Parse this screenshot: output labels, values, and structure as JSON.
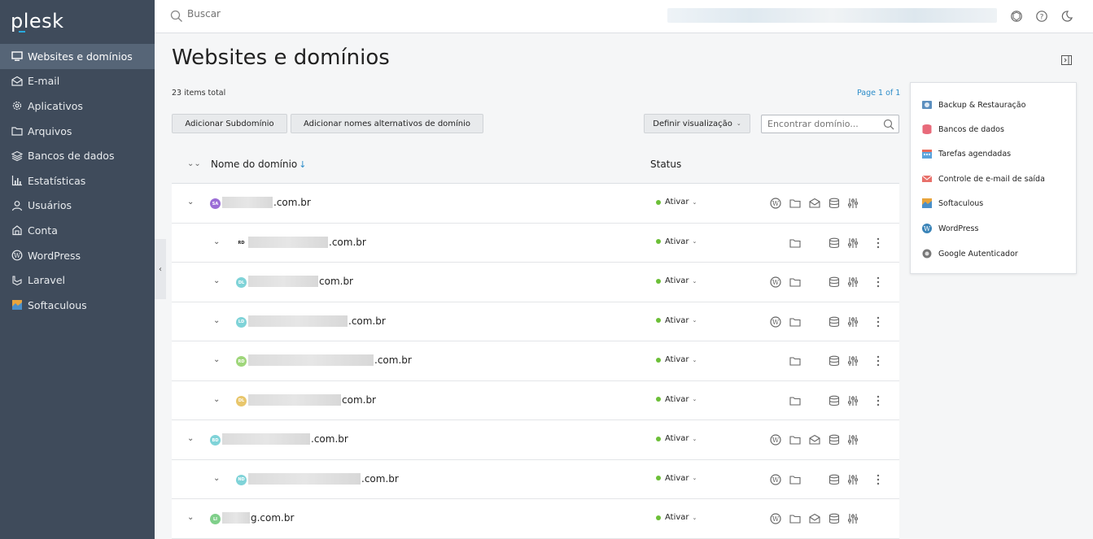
{
  "app": {
    "logo": "plesk"
  },
  "sidebar": {
    "items": [
      {
        "label": "Websites e domínios",
        "icon": "monitor-icon",
        "active": true
      },
      {
        "label": "E-mail",
        "icon": "envelope-icon"
      },
      {
        "label": "Aplicativos",
        "icon": "gear-icon"
      },
      {
        "label": "Arquivos",
        "icon": "folder-icon"
      },
      {
        "label": "Bancos de dados",
        "icon": "layers-icon"
      },
      {
        "label": "Estatísticas",
        "icon": "bar-chart-icon"
      },
      {
        "label": "Usuários",
        "icon": "user-icon"
      },
      {
        "label": "Conta",
        "icon": "account-icon"
      },
      {
        "label": "WordPress",
        "icon": "wordpress-icon"
      },
      {
        "label": "Laravel",
        "icon": "laravel-icon"
      },
      {
        "label": "Softaculous",
        "icon": "softaculous-icon"
      }
    ]
  },
  "topbar": {
    "search_placeholder": "Buscar",
    "icons": [
      "extensions-icon",
      "help-icon",
      "dark-mode-icon"
    ]
  },
  "main": {
    "title": "Websites e domínios",
    "items_total": "23 items total",
    "pagination": "Page 1 of 1",
    "buttons": {
      "add_subdomain": "Adicionar Subdomínio",
      "add_alias": "Adicionar nomes alternativos de domínio",
      "view": "Definir visualização"
    },
    "find_placeholder": "Encontrar domínio..."
  },
  "table": {
    "col_name": "Nome do domínio",
    "col_status": "Status",
    "rows": [
      {
        "suffix": ".com.br",
        "status": "Ativar",
        "badge": "SA",
        "badge_color": "#9b6dd6",
        "level": 0
      },
      {
        "suffix": ".com.br",
        "status": "Ativar",
        "badge": "RD",
        "badge_color": "#ffffff",
        "level": 1
      },
      {
        "suffix": "com.br",
        "status": "Ativar",
        "badge": "DL",
        "badge_color": "#7fd3d8",
        "level": 1
      },
      {
        "suffix": ".com.br",
        "status": "Ativar",
        "badge": "LD",
        "badge_color": "#7fd3d8",
        "level": 1
      },
      {
        "suffix": ".com.br",
        "status": "Ativar",
        "badge": "RD",
        "badge_color": "#9fd67a",
        "level": 1
      },
      {
        "suffix": "com.br",
        "status": "Ativar",
        "badge": "DL",
        "badge_color": "#e8c66c",
        "level": 1
      },
      {
        "suffix": ".com.br",
        "status": "Ativar",
        "badge": "BD",
        "badge_color": "#7fd3d8",
        "level": 0
      },
      {
        "suffix": ".com.br",
        "status": "Ativar",
        "badge": "ND",
        "badge_color": "#7fd3d8",
        "level": 1
      },
      {
        "suffix": "g.com.br",
        "status": "Ativar",
        "badge": "LI",
        "badge_color": "#7fcf8a",
        "level": 0
      }
    ]
  },
  "right_panel": {
    "items": [
      {
        "label": "Backup & Restauração",
        "icon": "backup-icon"
      },
      {
        "label": "Bancos de dados",
        "icon": "database-icon"
      },
      {
        "label": "Tarefas agendadas",
        "icon": "calendar-icon"
      },
      {
        "label": "Controle de e-mail de saída",
        "icon": "mail-icon"
      },
      {
        "label": "Softaculous",
        "icon": "softaculous-icon"
      },
      {
        "label": "WordPress",
        "icon": "wordpress-icon"
      },
      {
        "label": "Google Autenticador",
        "icon": "authenticator-icon"
      }
    ]
  }
}
